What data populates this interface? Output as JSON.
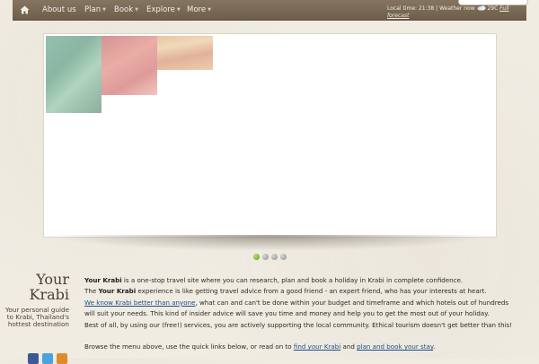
{
  "nav": {
    "items": [
      {
        "label": "About us",
        "has_menu": false
      },
      {
        "label": "Plan",
        "has_menu": true
      },
      {
        "label": "Book",
        "has_menu": true
      },
      {
        "label": "Explore",
        "has_menu": true
      },
      {
        "label": "More",
        "has_menu": true
      }
    ],
    "weather_text": "Local time: 21:38 | Weather now",
    "temperature": "29C",
    "forecast_link": "Full forecast"
  },
  "slideshow": {
    "slide_count": 4,
    "active_slide": 1
  },
  "brand": {
    "title_line1": "Your",
    "title_line2": "Krabi",
    "subtitle": "Your personal guide to Krabi, Thailand's hottest destination"
  },
  "content": {
    "p1_strong": "Your Krabi",
    "p1_rest": " is a one-stop travel site where you can research, plan and book a holiday in Krabi in complete confidence.",
    "p2_pre": "The ",
    "p2_strong": "Your Krabi",
    "p2_rest": " experience is like getting travel advice from a good friend - an expert friend, who has your interests at heart.",
    "p3_link": "We know Krabi better than anyone",
    "p3_rest": ", what can and can't be done within your budget and timeframe and which hotels out of hundreds will suit your needs. This kind of insider advice will save you time and money and help you to get the most out of your holiday.",
    "p4": "Best of all, by using our (free!) services, you are actively supporting the local community. Ethical tourism doesn't get better than this!",
    "p5_pre": "Browse the menu above, use the quick links below, or read on to ",
    "p5_link1_pre": "find ",
    "p5_link1_em": "your",
    "p5_link1_post": " Krabi",
    "p5_mid": " and ",
    "p5_link2": "plan and book your stay",
    "p5_end": "."
  },
  "colors": {
    "nav_bg": "#7a6a55",
    "page_bg": "#f0ece2",
    "link": "#1c4f8a",
    "active_dot": "#5a9a1a"
  }
}
